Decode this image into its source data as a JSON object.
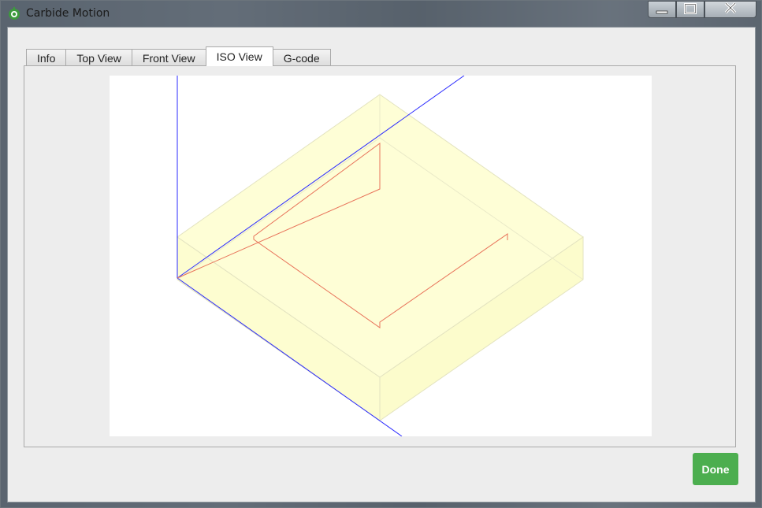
{
  "window": {
    "title": "Carbide Motion",
    "icon": "carbide-motion-icon",
    "controls": [
      "minimize-icon",
      "maximize-icon",
      "close-icon"
    ]
  },
  "tabs": [
    {
      "label": "Info",
      "active": false
    },
    {
      "label": "Top View",
      "active": false
    },
    {
      "label": "Front View",
      "active": false
    },
    {
      "label": "ISO View",
      "active": true
    },
    {
      "label": "G-code",
      "active": false
    }
  ],
  "viewport": {
    "view": "iso",
    "colors": {
      "axis": "#2b2bff",
      "stock_fill": "#fefed6",
      "stock_edge": "#e3e3c0",
      "toolpath": "#e8735a"
    }
  },
  "done_button": {
    "label": "Done",
    "color": "#4cae4f"
  }
}
